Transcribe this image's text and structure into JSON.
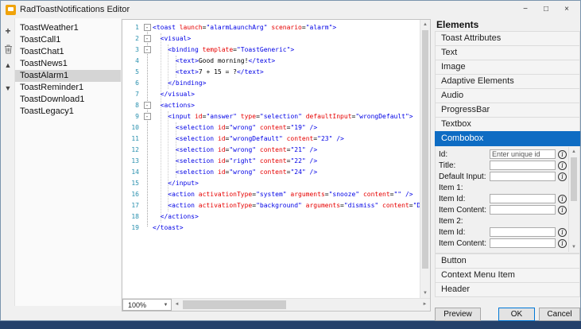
{
  "window": {
    "title": "RadToastNotifications Editor"
  },
  "icons": {
    "add": "+",
    "delete": "trash",
    "up": "▲",
    "down": "▼",
    "minimize": "−",
    "maximize": "□",
    "close": "×",
    "info": "i",
    "dropdown": "▼",
    "fold_collapse": "-",
    "scroll_up": "▲",
    "scroll_down": "▼",
    "scroll_left": "◄",
    "scroll_right": "►"
  },
  "toast_list": {
    "selected_index": 4,
    "items": [
      "ToastWeather1",
      "ToastCall1",
      "ToastChat1",
      "ToastNews1",
      "ToastAlarm1",
      "ToastReminder1",
      "ToastDownload1",
      "ToastLegacy1"
    ]
  },
  "editor": {
    "zoom": "100%",
    "lines": [
      {
        "n": 1,
        "fold": true,
        "tokens": [
          [
            "tag",
            "<toast"
          ],
          [
            "attr",
            " launch"
          ],
          [
            "pln",
            "="
          ],
          [
            "val",
            "\"alarmLaunchArg\""
          ],
          [
            "attr",
            " scenario"
          ],
          [
            "pln",
            "="
          ],
          [
            "val",
            "\"alarm\""
          ],
          [
            "tag",
            ">"
          ]
        ]
      },
      {
        "n": 2,
        "fold": true,
        "tokens": [
          [
            "pln",
            "  "
          ],
          [
            "tag",
            "<visual>"
          ]
        ]
      },
      {
        "n": 3,
        "fold": true,
        "tokens": [
          [
            "pln",
            "    "
          ],
          [
            "tag",
            "<binding"
          ],
          [
            "attr",
            " template"
          ],
          [
            "pln",
            "="
          ],
          [
            "val",
            "\"ToastGeneric\""
          ],
          [
            "tag",
            ">"
          ]
        ]
      },
      {
        "n": 4,
        "fold": false,
        "tokens": [
          [
            "pln",
            "      "
          ],
          [
            "tag",
            "<text>"
          ],
          [
            "txt",
            "Good morning!"
          ],
          [
            "tag",
            "</text>"
          ]
        ]
      },
      {
        "n": 5,
        "fold": false,
        "tokens": [
          [
            "pln",
            "      "
          ],
          [
            "tag",
            "<text>"
          ],
          [
            "txt",
            "7 + 15 = ?"
          ],
          [
            "tag",
            "</text>"
          ]
        ]
      },
      {
        "n": 6,
        "fold": false,
        "tokens": [
          [
            "pln",
            "    "
          ],
          [
            "tag",
            "</binding>"
          ]
        ]
      },
      {
        "n": 7,
        "fold": false,
        "tokens": [
          [
            "pln",
            "  "
          ],
          [
            "tag",
            "</visual>"
          ]
        ]
      },
      {
        "n": 8,
        "fold": true,
        "tokens": [
          [
            "pln",
            "  "
          ],
          [
            "tag",
            "<actions>"
          ]
        ]
      },
      {
        "n": 9,
        "fold": true,
        "tokens": [
          [
            "pln",
            "    "
          ],
          [
            "tag",
            "<input"
          ],
          [
            "attr",
            " id"
          ],
          [
            "pln",
            "="
          ],
          [
            "val",
            "\"answer\""
          ],
          [
            "attr",
            " type"
          ],
          [
            "pln",
            "="
          ],
          [
            "val",
            "\"selection\""
          ],
          [
            "attr",
            " defaultInput"
          ],
          [
            "pln",
            "="
          ],
          [
            "val",
            "\"wrongDefault\""
          ],
          [
            "tag",
            ">"
          ]
        ]
      },
      {
        "n": 10,
        "fold": false,
        "tokens": [
          [
            "pln",
            "      "
          ],
          [
            "tag",
            "<selection"
          ],
          [
            "attr",
            " id"
          ],
          [
            "pln",
            "="
          ],
          [
            "val",
            "\"wrong\""
          ],
          [
            "attr",
            " content"
          ],
          [
            "pln",
            "="
          ],
          [
            "val",
            "\"19\""
          ],
          [
            "tag",
            " />"
          ]
        ]
      },
      {
        "n": 11,
        "fold": false,
        "tokens": [
          [
            "pln",
            "      "
          ],
          [
            "tag",
            "<selection"
          ],
          [
            "attr",
            " id"
          ],
          [
            "pln",
            "="
          ],
          [
            "val",
            "\"wrongDefault\""
          ],
          [
            "attr",
            " content"
          ],
          [
            "pln",
            "="
          ],
          [
            "val",
            "\"23\""
          ],
          [
            "tag",
            " />"
          ]
        ]
      },
      {
        "n": 12,
        "fold": false,
        "tokens": [
          [
            "pln",
            "      "
          ],
          [
            "tag",
            "<selection"
          ],
          [
            "attr",
            " id"
          ],
          [
            "pln",
            "="
          ],
          [
            "val",
            "\"wrong\""
          ],
          [
            "attr",
            " content"
          ],
          [
            "pln",
            "="
          ],
          [
            "val",
            "\"21\""
          ],
          [
            "tag",
            " />"
          ]
        ]
      },
      {
        "n": 13,
        "fold": false,
        "tokens": [
          [
            "pln",
            "      "
          ],
          [
            "tag",
            "<selection"
          ],
          [
            "attr",
            " id"
          ],
          [
            "pln",
            "="
          ],
          [
            "val",
            "\"right\""
          ],
          [
            "attr",
            " content"
          ],
          [
            "pln",
            "="
          ],
          [
            "val",
            "\"22\""
          ],
          [
            "tag",
            " />"
          ]
        ]
      },
      {
        "n": 14,
        "fold": false,
        "tokens": [
          [
            "pln",
            "      "
          ],
          [
            "tag",
            "<selection"
          ],
          [
            "attr",
            " id"
          ],
          [
            "pln",
            "="
          ],
          [
            "val",
            "\"wrong\""
          ],
          [
            "attr",
            " content"
          ],
          [
            "pln",
            "="
          ],
          [
            "val",
            "\"24\""
          ],
          [
            "tag",
            " />"
          ]
        ]
      },
      {
        "n": 15,
        "fold": false,
        "tokens": [
          [
            "pln",
            "    "
          ],
          [
            "tag",
            "</input>"
          ]
        ]
      },
      {
        "n": 16,
        "fold": false,
        "tokens": [
          [
            "pln",
            "    "
          ],
          [
            "tag",
            "<action"
          ],
          [
            "attr",
            " activationType"
          ],
          [
            "pln",
            "="
          ],
          [
            "val",
            "\"system\""
          ],
          [
            "attr",
            " arguments"
          ],
          [
            "pln",
            "="
          ],
          [
            "val",
            "\"snooze\""
          ],
          [
            "attr",
            " content"
          ],
          [
            "pln",
            "="
          ],
          [
            "val",
            "\"\""
          ],
          [
            "tag",
            " />"
          ]
        ]
      },
      {
        "n": 17,
        "fold": false,
        "tokens": [
          [
            "pln",
            "    "
          ],
          [
            "tag",
            "<action"
          ],
          [
            "attr",
            " activationType"
          ],
          [
            "pln",
            "="
          ],
          [
            "val",
            "\"background\""
          ],
          [
            "attr",
            " arguments"
          ],
          [
            "pln",
            "="
          ],
          [
            "val",
            "\"dismiss\""
          ],
          [
            "attr",
            " content"
          ],
          [
            "pln",
            "="
          ],
          [
            "val",
            "\"Dis"
          ]
        ]
      },
      {
        "n": 18,
        "fold": false,
        "tokens": [
          [
            "pln",
            "  "
          ],
          [
            "tag",
            "</actions>"
          ]
        ]
      },
      {
        "n": 19,
        "fold": false,
        "tokens": [
          [
            "tag",
            "</toast>"
          ]
        ]
      }
    ]
  },
  "elements": {
    "title": "Elements",
    "sections": [
      "Toast Attributes",
      "Text",
      "Image",
      "Adaptive Elements",
      "Audio",
      "ProgressBar",
      "Textbox",
      "Combobox"
    ],
    "selected_section": "Combobox",
    "form_rows": [
      {
        "label": "Id:",
        "placeholder": "Enter unique id",
        "value": "",
        "info": true
      },
      {
        "label": "Title:",
        "value": "",
        "info": true
      },
      {
        "label": "Default Input:",
        "value": "",
        "info": true
      },
      {
        "label": "Item 1:",
        "group": true
      },
      {
        "label": "Item Id:",
        "value": "",
        "info": true
      },
      {
        "label": "Item Content:",
        "value": "",
        "info": true
      },
      {
        "label": "Item 2:",
        "group": true
      },
      {
        "label": "Item Id:",
        "value": "",
        "info": true
      },
      {
        "label": "Item Content:",
        "value": "",
        "info": true
      }
    ],
    "bottom_sections": [
      "Button",
      "Context Menu Item",
      "Header"
    ]
  },
  "footer": {
    "preview": "Preview",
    "ok": "OK",
    "cancel": "Cancel"
  }
}
